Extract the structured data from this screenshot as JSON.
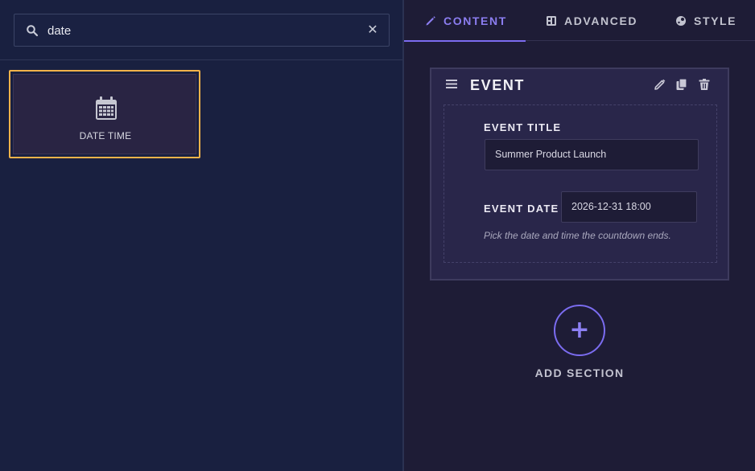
{
  "search": {
    "value": "date",
    "icon": "search-icon",
    "clear_icon": "close-icon",
    "clear_glyph": "✕"
  },
  "widgets": [
    {
      "label": "DATE TIME",
      "icon": "calendar-icon",
      "selected": true
    }
  ],
  "tabs": [
    {
      "label": "CONTENT",
      "icon": "pencil-icon",
      "active": true
    },
    {
      "label": "ADVANCED",
      "icon": "layout-icon",
      "active": false
    },
    {
      "label": "STYLE",
      "icon": "palette-icon",
      "active": false
    }
  ],
  "section": {
    "title": "EVENT",
    "fields": {
      "event_title": {
        "label": "EVENT TITLE",
        "value": "Summer Product Launch"
      },
      "event_date": {
        "label": "EVENT DATE",
        "value": "2026-12-31 18:00",
        "help": "Pick the date and time the countdown ends."
      }
    }
  },
  "add_section": {
    "label": "ADD SECTION",
    "glyph": "+"
  },
  "colors": {
    "accent": "#7c6cf0",
    "selection": "#f2b34a",
    "left_bg": "#192040",
    "right_bg": "#1e1c36"
  }
}
